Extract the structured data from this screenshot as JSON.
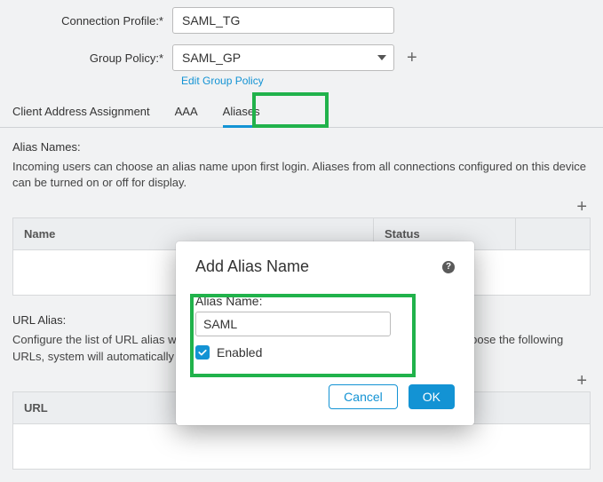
{
  "form": {
    "connection_profile_label": "Connection Profile:*",
    "connection_profile_value": "SAML_TG",
    "group_policy_label": "Group Policy:*",
    "group_policy_value": "SAML_GP",
    "edit_group_policy": "Edit Group Policy"
  },
  "tabs": {
    "client_address": "Client Address Assignment",
    "aaa": "AAA",
    "aliases": "Aliases"
  },
  "alias_names": {
    "title": "Alias Names:",
    "desc": "Incoming users can choose an alias name upon first login. Aliases from all connections configured on this device can be turned on or off for display.",
    "col_name": "Name",
    "col_status": "Status"
  },
  "url_alias": {
    "title": "URL Alias:",
    "desc": "Configure the list of URL alias which your endpoints can select on web access. If users choose the following URLs, system will automatically log them in via this connection profile.",
    "col_url": "URL"
  },
  "modal": {
    "title": "Add Alias Name",
    "field_label": "Alias Name:",
    "field_value": "SAML",
    "enabled_label": "Enabled",
    "cancel": "Cancel",
    "ok": "OK"
  }
}
